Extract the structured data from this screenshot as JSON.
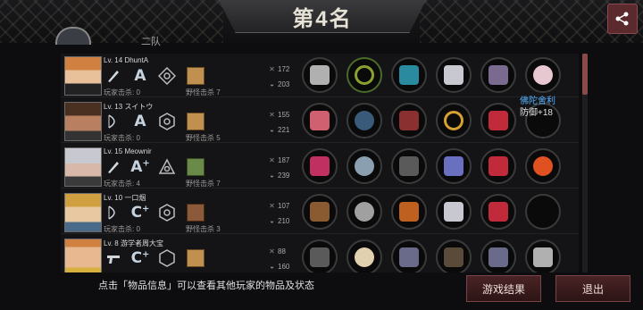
{
  "header": {
    "title": "第4名",
    "tab_peek_label": "二队"
  },
  "players": [
    {
      "level": "Lv. 14",
      "name": "DhuntA",
      "kills_label": "玩家击杀:",
      "kills": "0",
      "monster_kills_label": "野怪击杀",
      "monster_kills": "7",
      "grade": "A",
      "grade_plus": "",
      "attack": "172",
      "defense": "203",
      "weapon": "knife-icon"
    },
    {
      "level": "Lv. 13",
      "name": "スイトウ",
      "kills_label": "玩家击杀:",
      "kills": "0",
      "monster_kills_label": "野怪击杀",
      "monster_kills": "5",
      "grade": "A",
      "grade_plus": "",
      "attack": "155",
      "defense": "221",
      "weapon": "bow-icon"
    },
    {
      "level": "Lv. 15",
      "name": "Meownir",
      "kills_label": "玩家击杀:",
      "kills": "4",
      "monster_kills_label": "野怪击杀",
      "monster_kills": "7",
      "grade": "A",
      "grade_plus": "+",
      "attack": "187",
      "defense": "239",
      "weapon": "knife-icon"
    },
    {
      "level": "Lv. 10",
      "name": "一口烟",
      "kills_label": "玩家击杀:",
      "kills": "0",
      "monster_kills_label": "野怪击杀",
      "monster_kills": "3",
      "grade": "C",
      "grade_plus": "+",
      "attack": "107",
      "defense": "210",
      "weapon": "bow-icon"
    },
    {
      "level": "Lv. 8",
      "name": "游学者周大宝",
      "kills_label": "",
      "kills": "",
      "monster_kills_label": "",
      "monster_kills": "",
      "grade": "C",
      "grade_plus": "+",
      "attack": "88",
      "defense": "160",
      "weapon": "pistol-icon"
    }
  ],
  "tooltip": {
    "name": "佛陀舍利",
    "stat": "防御+18"
  },
  "footer": {
    "info": "点击「物品信息」可以查看其他玩家的物品及状态",
    "result_button": "游戏结果",
    "exit_button": "退出"
  },
  "colors": {
    "accent_red": "#7a4446",
    "panel_bg": "#141416",
    "tooltip_blue": "#5ab4ff"
  }
}
